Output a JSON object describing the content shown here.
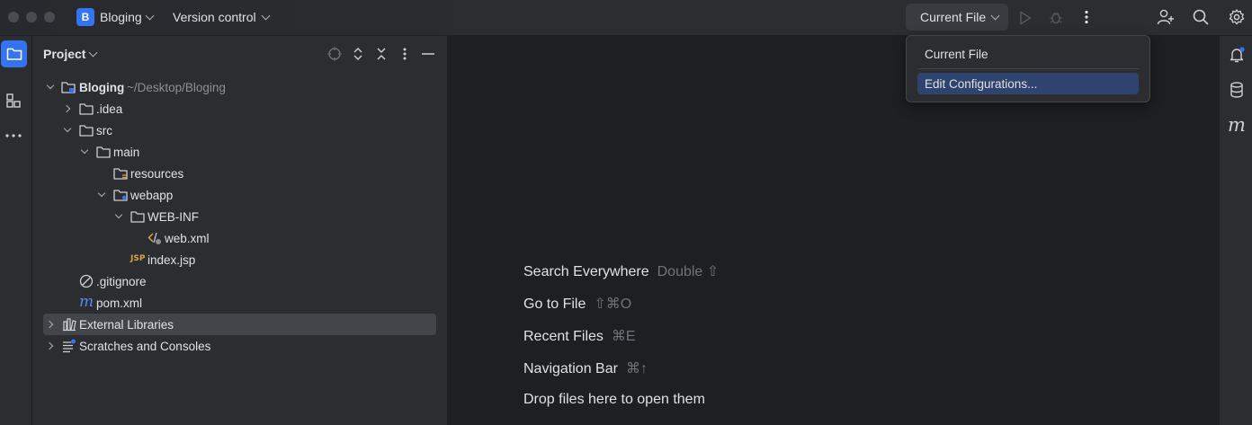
{
  "titlebar": {
    "project_badge": "B",
    "project_name": "Bloging",
    "vcs_label": "Version control",
    "run_config": "Current File"
  },
  "project_panel": {
    "title": "Project"
  },
  "tree": [
    {
      "label": "Bloging",
      "path": "~/Desktop/Bloging"
    },
    {
      "label": ".idea"
    },
    {
      "label": "src"
    },
    {
      "label": "main"
    },
    {
      "label": "resources"
    },
    {
      "label": "webapp"
    },
    {
      "label": "WEB-INF"
    },
    {
      "label": "web.xml"
    },
    {
      "label": "index.jsp"
    },
    {
      "label": ".gitignore"
    },
    {
      "label": "pom.xml"
    },
    {
      "label": "External Libraries"
    },
    {
      "label": "Scratches and Consoles"
    }
  ],
  "editor_hints": [
    {
      "label": "Search Everywhere",
      "shortcut": "Double ⇧"
    },
    {
      "label": "Go to File",
      "shortcut": "⇧⌘O"
    },
    {
      "label": "Recent Files",
      "shortcut": "⌘E"
    },
    {
      "label": "Navigation Bar",
      "shortcut": "⌘↑"
    },
    {
      "label": "Drop files here to open them",
      "shortcut": ""
    }
  ],
  "run_popup": {
    "items": [
      "Current File",
      "Edit Configurations..."
    ]
  },
  "icons": {
    "jsp_badge": "JSP",
    "maven_glyph": "m"
  },
  "colors": {
    "accent": "#3574f0",
    "selection": "#2e436e"
  }
}
